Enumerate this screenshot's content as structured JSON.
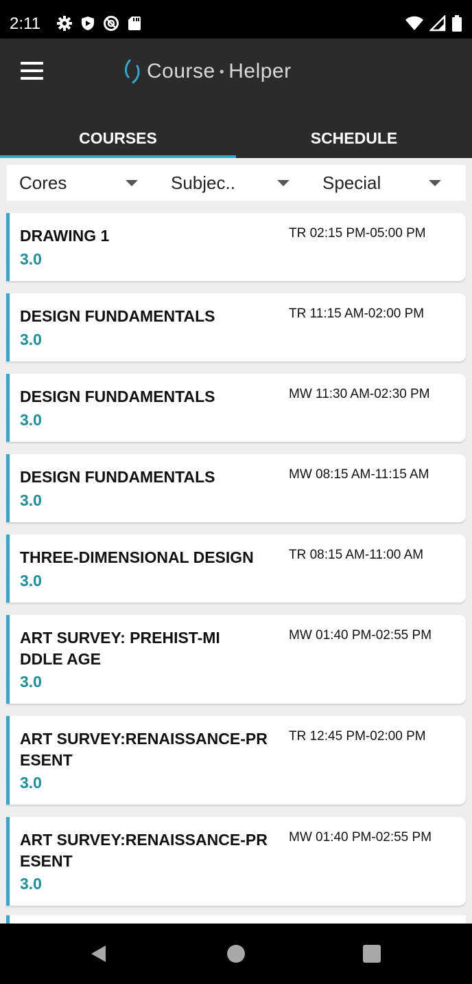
{
  "status_bar": {
    "time": "2:11",
    "left_icons": [
      "gear-icon",
      "shield-icon",
      "no-entry-icon",
      "sd-card-icon"
    ],
    "right_icons": [
      "wifi-icon",
      "cell-signal-icon",
      "battery-icon"
    ]
  },
  "app_bar": {
    "logo_text_1": "Course",
    "logo_dot": "•",
    "logo_text_2": "Helper"
  },
  "tabs": [
    {
      "label": "COURSES",
      "active": true
    },
    {
      "label": "SCHEDULE",
      "active": false
    }
  ],
  "filters": [
    {
      "label": "Cores"
    },
    {
      "label": "Subjec.."
    },
    {
      "label": "Special"
    }
  ],
  "courses": [
    {
      "title": "DRAWING 1",
      "credits": "3.0",
      "time": "TR 02:15 PM-05:00 PM"
    },
    {
      "title": "DESIGN FUNDAMENTALS",
      "credits": "3.0",
      "time": "TR 11:15 AM-02:00 PM"
    },
    {
      "title": "DESIGN FUNDAMENTALS",
      "credits": "3.0",
      "time": "MW 11:30 AM-02:30 PM"
    },
    {
      "title": "DESIGN FUNDAMENTALS",
      "credits": "3.0",
      "time": "MW 08:15 AM-11:15 AM"
    },
    {
      "title": "THREE-DIMENSIONAL DESIGN",
      "credits": "3.0",
      "time": "TR 08:15 AM-11:00 AM"
    },
    {
      "title": "ART SURVEY: PREHIST-MIDDLE AGE",
      "credits": "3.0",
      "time": "MW 01:40 PM-02:55 PM"
    },
    {
      "title": "ART SURVEY:RENAISSANCE-PRESENT",
      "credits": "3.0",
      "time": "TR 12:45 PM-02:00 PM"
    },
    {
      "title": "ART SURVEY:RENAISSANCE-PRESENT",
      "credits": "3.0",
      "time": "MW 01:40 PM-02:55 PM"
    }
  ],
  "colors": {
    "accent": "#2fa9cf",
    "credits": "#1b8f9c",
    "app_bar": "#2b2b2b",
    "background": "#eeeeee"
  },
  "nav_bar": {
    "buttons": [
      "back-icon",
      "home-icon",
      "recents-icon"
    ]
  }
}
